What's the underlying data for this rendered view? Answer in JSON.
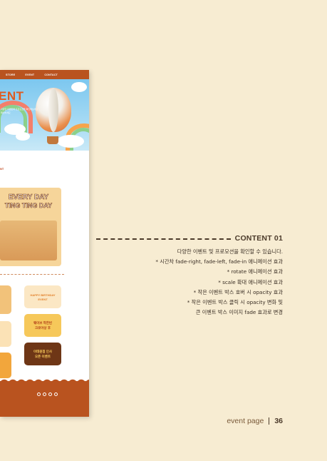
{
  "site": {
    "nav": [
      "STORE",
      "EVENT",
      "CONTACT"
    ],
    "hero_title": "ENT",
    "hero_sub_1": "다양한 이벤트와 프로모션을 확인해보세요",
    "hero_sub_2": "확인하세요",
    "section_label": "NT",
    "promo_line_1": "EVERY DAY",
    "promo_line_2": "TING TING DAY",
    "card_happy_1": "HAPPY BIRTHDAY",
    "card_happy_2": "EVENT",
    "card_yellow_1": "웨이브 착한빈",
    "card_yellow_2": "크로아상 후",
    "card_brown_1": "이태원점 인사",
    "card_brown_2": "오픈 이벤트"
  },
  "content": {
    "title": "CONTENT 01",
    "lines": [
      "다양한 이벤트 및 프로모션을 확인할 수 있습니다.",
      "* 시간차 fade-right, fade-left, fade-in 애니메이션 효과",
      "* rotate 애니메이션 효과",
      "* scale 확대 애니메이션 효과",
      "* 작은 이벤트 박스 호버 시 opacity 효과",
      "* 작은 이벤트 박스 클릭 시 opacity 변화 및",
      "큰 이벤트 박스 이미지 fade 효과로 변경"
    ]
  },
  "footer": {
    "label": "event page",
    "page_number": "36"
  },
  "colors": {
    "background": "#f7ecd2",
    "site_nav": "#b9531f",
    "accent_orange": "#e05a1e",
    "text_dark": "#4b3a2a"
  }
}
